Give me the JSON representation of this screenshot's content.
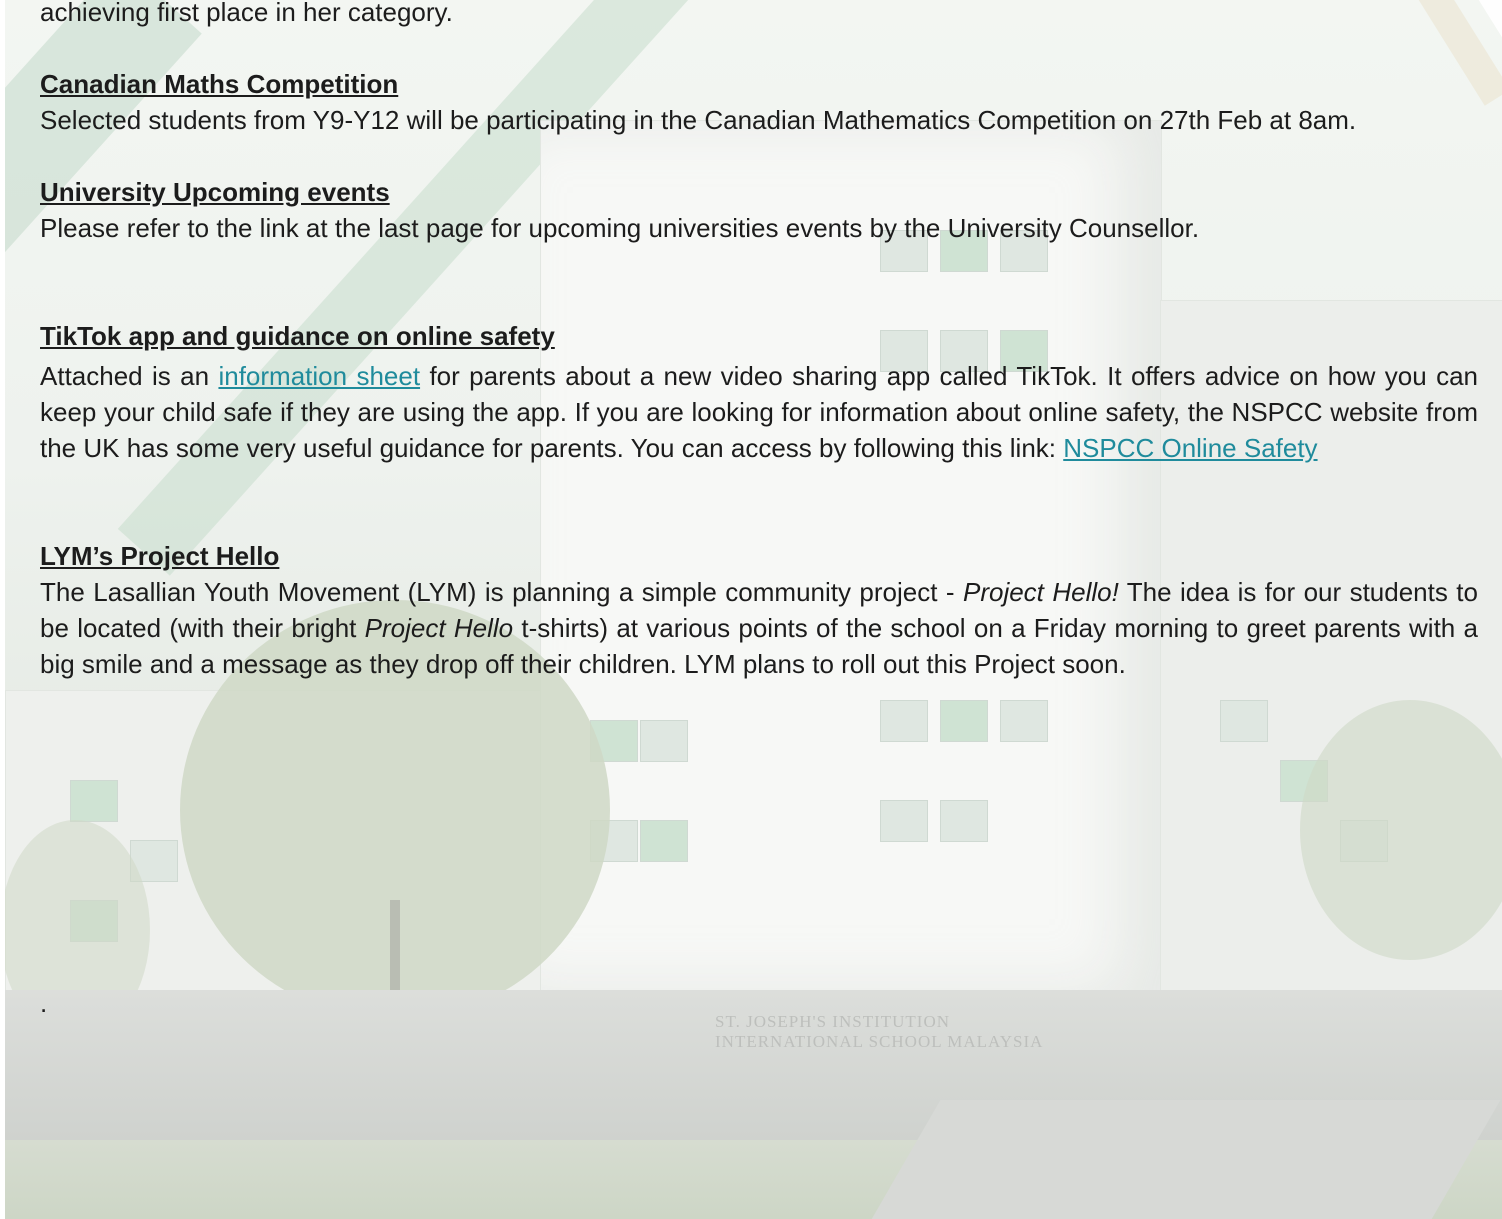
{
  "intro": {
    "fragment": "achieving first place in her category."
  },
  "sections": [
    {
      "heading": "Canadian Maths Competition",
      "body": "Selected students from Y9-Y12 will be participating in the Canadian Mathematics Competition on 27th Feb at 8am."
    },
    {
      "heading": "University Upcoming events",
      "body": "Please refer to the link at the last page for upcoming universities events by the University Counsellor."
    },
    {
      "heading": "TikTok app and guidance on online safety",
      "body_before_link": "Attached is an ",
      "link1": "information sheet",
      "body_middle": " for parents about a new video sharing app called TikTok. It offers advice on how you can keep your child safe if they are using the app. If you are looking for information about online safety, the NSPCC website from the UK has some very useful guidance for parents. You can access by following this link:  ",
      "link2": "NSPCC Online Safety"
    },
    {
      "heading": "LYM’s Project Hello",
      "body_part1": "The Lasallian Youth Movement (LYM) is planning a simple community project - ",
      "italic1": "Project Hello!",
      "body_part2": " The idea is for our students to be located (with their bright ",
      "italic2": "Project Hello",
      "body_part3": " t-shirts) at various points of the school on a Friday morning to greet parents with a big smile and a message as they drop off their children. LYM plans to roll out this Project soon."
    }
  ],
  "trailing_dot": ".",
  "background": {
    "sign_line1": "ST. JOSEPH'S INSTITUTION",
    "sign_line2": "INTERNATIONAL SCHOOL MALAYSIA",
    "link_color": "#1f8b9c",
    "accent_green": "#cfe3d3"
  }
}
